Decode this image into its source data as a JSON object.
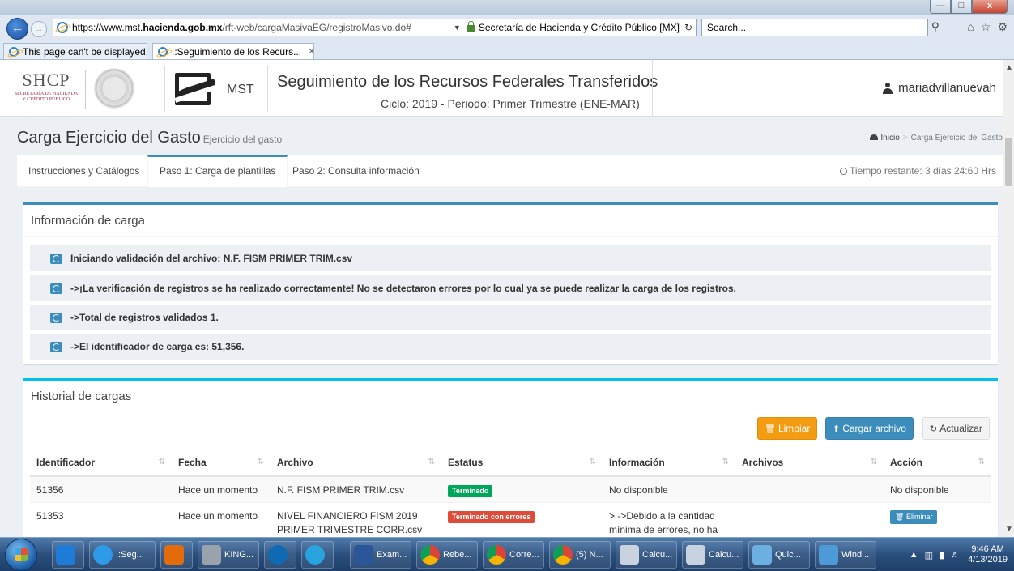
{
  "browser": {
    "url_prefix": "https://www.mst.",
    "url_domain": "hacienda.gob.mx",
    "url_path": "/rft-web/cargaMasivaEG/registroMasivo.do#",
    "site_identity": "Secretaría de Hacienda y Crédito Público [MX]",
    "search_placeholder": "Search...",
    "tabs": [
      {
        "label": "This page can't be displayed"
      },
      {
        "label": ".:Seguimiento de los Recurs..."
      }
    ],
    "win_min": "—",
    "win_max": "□",
    "win_close": "x"
  },
  "header": {
    "logo_text": "SHCP",
    "logo_sub1": "SECRETARÍA DE HACIENDA",
    "logo_sub2": "Y CRÉDITO PÚBLICO",
    "mst_text": "MST",
    "title": "Seguimiento de los Recursos Federales Transferidos",
    "subtitle": "Ciclo: 2019 - Periodo: Primer Trimestre (ENE-MAR)",
    "user": "mariadvillanuevah"
  },
  "content_header": {
    "title": "Carga Ejercicio del Gasto",
    "small": "Ejercicio del gasto",
    "breadcrumb_home": "Inicio",
    "breadcrumb_current": "Carga Ejercicio del Gasto"
  },
  "page_tabs": [
    {
      "label": "Instrucciones y Catálogos"
    },
    {
      "label": "Paso 1: Carga de plantillas"
    },
    {
      "label": "Paso 2: Consulta información"
    }
  ],
  "timer": "Tiempo restante: 3 días 24:60 Hrs",
  "info_box": {
    "title": "Información de carga",
    "rows": [
      "Iniciando validación del archivo: N.F. FISM PRIMER TRIM.csv",
      "->¡La verificación de registros se ha realizado correctamente! No se detectaron errores por lo cual ya se puede realizar la carga de los registros.",
      "->Total de registros validados 1.",
      "->El identificador de carga es: 51,356."
    ]
  },
  "history": {
    "title": "Historial de cargas",
    "buttons": {
      "clear": "Limpiar",
      "upload": "Cargar archivo",
      "refresh": "Actualizar"
    },
    "columns": [
      "Identificador",
      "Fecha",
      "Archivo",
      "Estatus",
      "Información",
      "Archivos",
      "Acción"
    ],
    "rows": [
      {
        "id": "51356",
        "fecha": "Hace un momento",
        "archivo": "N.F. FISM PRIMER TRIM.csv",
        "estatus": "Terminado",
        "informacion": "No disponible",
        "archivos": "",
        "accion": "No disponible"
      },
      {
        "id": "51353",
        "fecha": "Hace un momento",
        "archivo": "NIVEL FINANCIERO FISM 2019 PRIMER TRIMESTRE CORR.csv",
        "estatus": "Terminado con errores",
        "informacion": "> ->Debido a la cantidad mínima de errores, no ha sido necesario generar un archivo de errores, por lo cual se",
        "archivos": "",
        "accion": "Eliminar"
      }
    ]
  },
  "taskbar": {
    "items": [
      {
        "label": ".:Seg..."
      },
      {
        "label": ""
      },
      {
        "label": "KING..."
      },
      {
        "label": ""
      },
      {
        "label": ""
      },
      {
        "label": "Exam..."
      },
      {
        "label": "Rebe..."
      },
      {
        "label": "Corre..."
      },
      {
        "label": "(5) N..."
      },
      {
        "label": "Calcu..."
      },
      {
        "label": "Calcu..."
      },
      {
        "label": "Quic..."
      },
      {
        "label": "Wind..."
      }
    ],
    "time": "9:46 AM",
    "date": "4/13/2019"
  },
  "colors": {
    "primary": "#3c8dbc",
    "info": "#00c0ef",
    "warning": "#f39c12",
    "success": "#00a65a",
    "danger": "#dd4b39"
  }
}
